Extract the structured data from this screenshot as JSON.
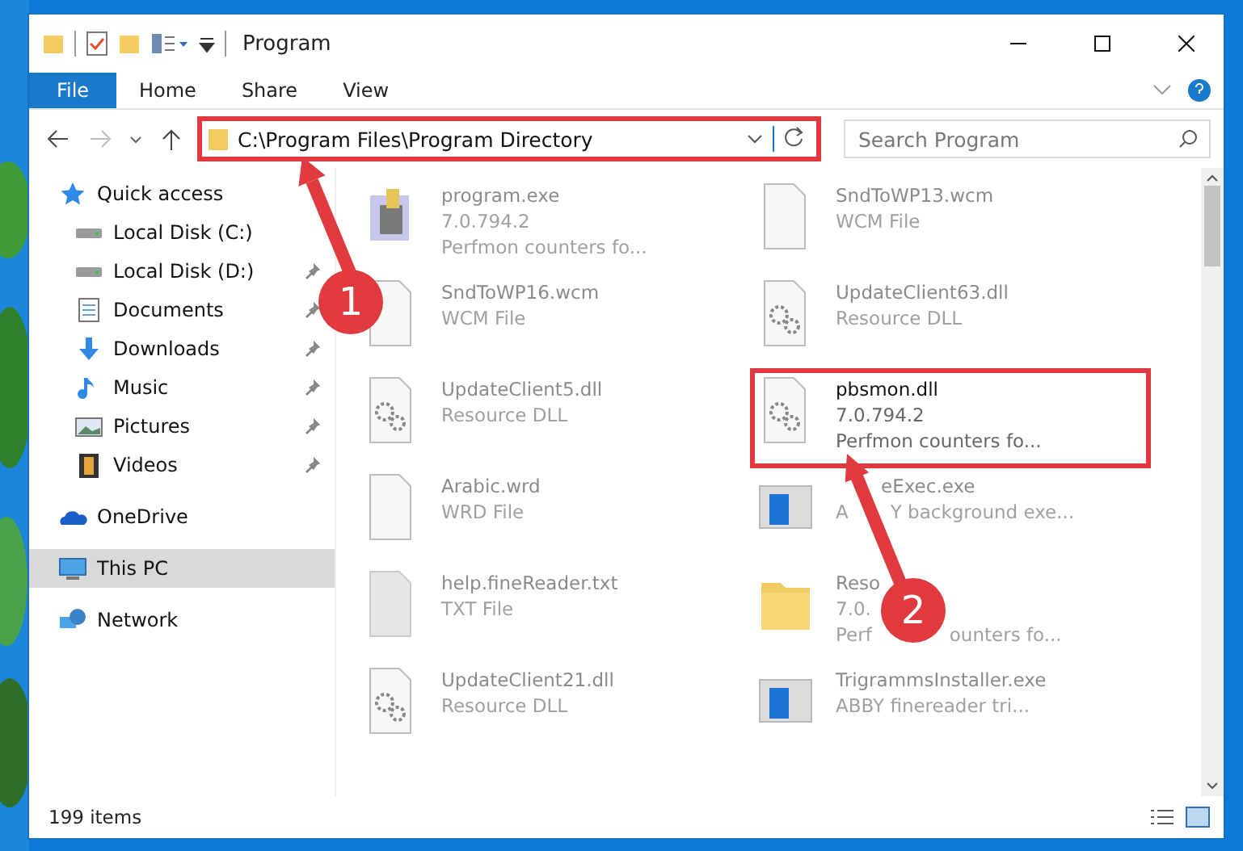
{
  "window": {
    "title": "Program"
  },
  "ribbon_tabs": [
    {
      "label": "File",
      "selected": true
    },
    {
      "label": "Home",
      "selected": false
    },
    {
      "label": "Share",
      "selected": false
    },
    {
      "label": "View",
      "selected": false
    }
  ],
  "address": {
    "path": "C:\\Program Files\\Program Directory",
    "highlighted": true
  },
  "search": {
    "placeholder": "Search Program"
  },
  "sidebar": {
    "items": [
      {
        "label": "Quick access",
        "kind": "star",
        "selected": false,
        "children": [
          {
            "label": "Local Disk (C:)",
            "kind": "drive",
            "selected": false,
            "pinned": false
          },
          {
            "label": "Local Disk (D:)",
            "kind": "drive",
            "selected": false,
            "pinned": true
          },
          {
            "label": "Documents",
            "kind": "documents",
            "selected": false,
            "pinned": true
          },
          {
            "label": "Downloads",
            "kind": "download",
            "selected": false,
            "pinned": true
          },
          {
            "label": "Music",
            "kind": "music",
            "selected": false,
            "pinned": true
          },
          {
            "label": "Pictures",
            "kind": "pictures",
            "selected": false,
            "pinned": true
          },
          {
            "label": "Videos",
            "kind": "videos",
            "selected": false,
            "pinned": true
          }
        ]
      },
      {
        "label": "OneDrive",
        "kind": "cloud",
        "selected": false
      },
      {
        "label": "This PC",
        "kind": "pc",
        "selected": true
      },
      {
        "label": "Network",
        "kind": "network",
        "selected": false
      }
    ]
  },
  "files": [
    {
      "kind": "exe",
      "highlighted": false,
      "lines": [
        "program.exe",
        "7.0.794.2",
        "Perfmon counters fo..."
      ]
    },
    {
      "kind": "blank",
      "highlighted": false,
      "lines": [
        "SndToWP13.wcm",
        "WCM File"
      ]
    },
    {
      "kind": "blank",
      "highlighted": false,
      "lines": [
        "SndToWP16.wcm",
        "WCM File"
      ]
    },
    {
      "kind": "dll",
      "highlighted": false,
      "lines": [
        "UpdateClient63.dll",
        "Resource DLL"
      ]
    },
    {
      "kind": "dll",
      "highlighted": false,
      "lines": [
        "UpdateClient5.dll",
        "Resource DLL"
      ]
    },
    {
      "kind": "dll",
      "highlighted": true,
      "lines": [
        "pbsmon.dll",
        "7.0.794.2",
        "Perfmon counters fo..."
      ]
    },
    {
      "kind": "blank",
      "highlighted": false,
      "lines": [
        "Arabic.wrd",
        "WRD File"
      ]
    },
    {
      "kind": "app",
      "highlighted": false,
      "lines": [
        {
          "lead": true,
          "parts": [
            "eExec.exe"
          ]
        },
        {
          "lead": false,
          "parts": [
            "A",
            "Y background exe..."
          ]
        }
      ]
    },
    {
      "kind": "text",
      "highlighted": false,
      "lines": [
        "help.fineReader.txt",
        "TXT File"
      ]
    },
    {
      "kind": "folder",
      "highlighted": false,
      "lines": [
        "Reso",
        "7.0.",
        {
          "lead": false,
          "parts": [
            "Perf",
            "ounters fo..."
          ]
        }
      ]
    },
    {
      "kind": "dll",
      "highlighted": false,
      "lines": [
        "UpdateClient21.dll",
        "Resource DLL"
      ]
    },
    {
      "kind": "app",
      "highlighted": false,
      "lines": [
        "TrigrammsInstaller.exe",
        "ABBY finereader tri..."
      ]
    }
  ],
  "status_bar": {
    "count": "199 items"
  },
  "annotations": [
    {
      "label": "1"
    },
    {
      "label": "2"
    }
  ]
}
